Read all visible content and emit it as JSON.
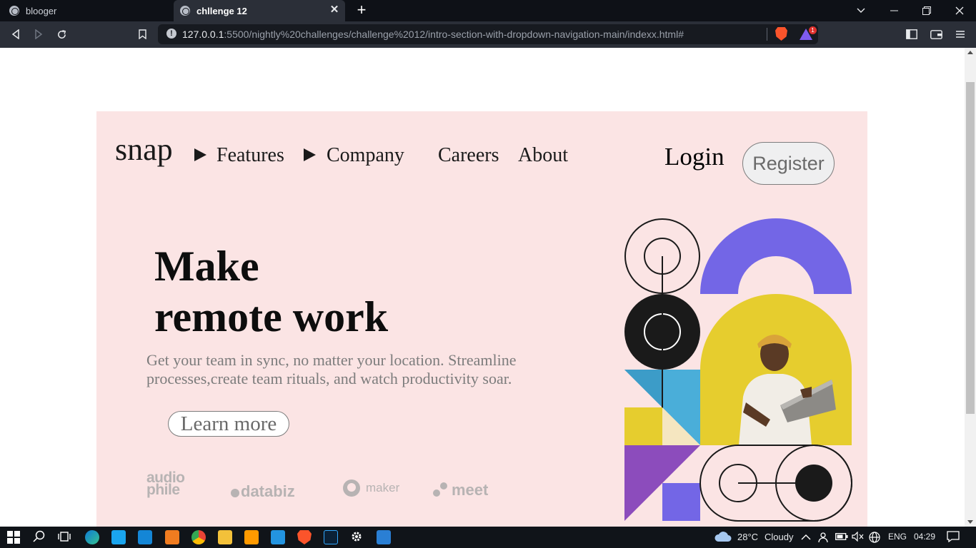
{
  "browser": {
    "tabs": [
      {
        "title": "blooger",
        "active": false
      },
      {
        "title": "chllenge 12",
        "active": true
      }
    ],
    "new_tab_label": "+",
    "close_label": "✕",
    "url_host": "127.0.0.1",
    "url_rest": ":5500/nightly%20challenges/challenge%2012/intro-section-with-dropdown-navigation-main/indexx.html#",
    "rewards_count": "1"
  },
  "page": {
    "logo": "snap",
    "nav": {
      "features": "Features",
      "company": "Company",
      "careers": "Careers",
      "about": "About"
    },
    "login": "Login",
    "register": "Register",
    "hero": {
      "title_line1": "Make",
      "title_line2": "remote work",
      "subtitle": "Get your team in sync, no matter your location. Streamline processes,create team rituals, and watch productivity soar.",
      "cta": "Learn more"
    },
    "clients": {
      "audiophile_line1": "audio",
      "audiophile_line2": "phile",
      "databiz": "databiz",
      "maker": "maker",
      "meet": "meet"
    },
    "colors": {
      "background": "#fbe4e4",
      "purple": "#7366e6",
      "yellow": "#e6cd2e",
      "blue": "#4aaed9",
      "violet": "#8c4cbc",
      "dark": "#1a1a1a"
    }
  },
  "taskbar": {
    "weather_temp": "28°C",
    "weather_desc": "Cloudy",
    "language": "ENG",
    "time": "04:29"
  }
}
